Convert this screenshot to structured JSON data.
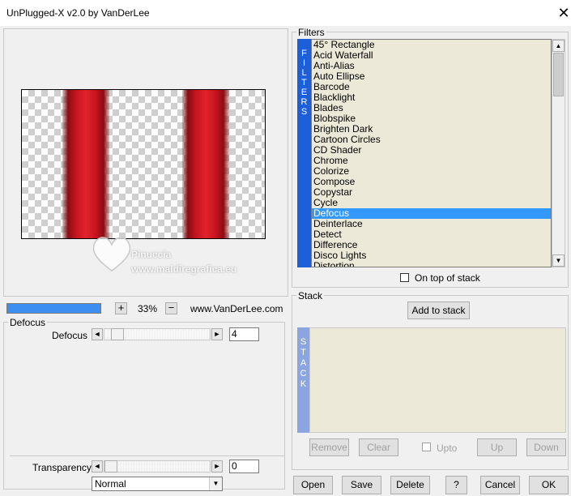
{
  "window": {
    "title": "UnPlugged-X v2.0 by VanDerLee",
    "close_glyph": "✕"
  },
  "preview": {
    "watermark_line1": "Pinuccia",
    "watermark_line2": "www.maldiregrafica.eu"
  },
  "zoom": {
    "plus": "+",
    "minus": "−",
    "value": "33%",
    "website": "www.VanDerLee.com",
    "progress_fraction": 1.0
  },
  "defocus_group": {
    "label": "Defocus",
    "param_label": "Defocus",
    "param_value": "4",
    "left_arrow": "◄",
    "right_arrow": "►"
  },
  "transparency": {
    "label": "Transparency",
    "value": "0",
    "left_arrow": "◄",
    "right_arrow": "►",
    "blend_mode": "Normal",
    "dropdown_arrow": "▼"
  },
  "filters": {
    "group_label": "Filters",
    "vertical_label": [
      "F",
      "I",
      "L",
      "T",
      "E",
      "R",
      "S"
    ],
    "items": [
      "45° Rectangle",
      "Acid Waterfall",
      "Anti-Alias",
      "Auto Ellipse",
      "Barcode",
      "Blacklight",
      "Blades",
      "Blobspike",
      "Brighten Dark",
      "Cartoon Circles",
      "CD Shader",
      "Chrome",
      "Colorize",
      "Compose",
      "Copystar",
      "Cycle",
      "Defocus",
      "Deinterlace",
      "Detect",
      "Difference",
      "Disco Lights",
      "Distortion"
    ],
    "selected_index": 16,
    "on_top_label": "On top of stack",
    "scroll_up": "▲",
    "scroll_down": "▼"
  },
  "stack": {
    "group_label": "Stack",
    "add_button": "Add to stack",
    "vertical_label": [
      "S",
      "T",
      "A",
      "C",
      "K"
    ],
    "remove": "Remove",
    "clear": "Clear",
    "upto": "Upto",
    "up": "Up",
    "down": "Down"
  },
  "footer": {
    "open": "Open",
    "save": "Save",
    "delete": "Delete",
    "help": "?",
    "cancel": "Cancel",
    "ok": "OK"
  },
  "colors": {
    "progress": "#3c8ff0",
    "filters_bar": "#1c5fd9",
    "stack_bar": "#8ba5e0",
    "selection": "#3399ff",
    "list_bg": "#ece9d8"
  }
}
